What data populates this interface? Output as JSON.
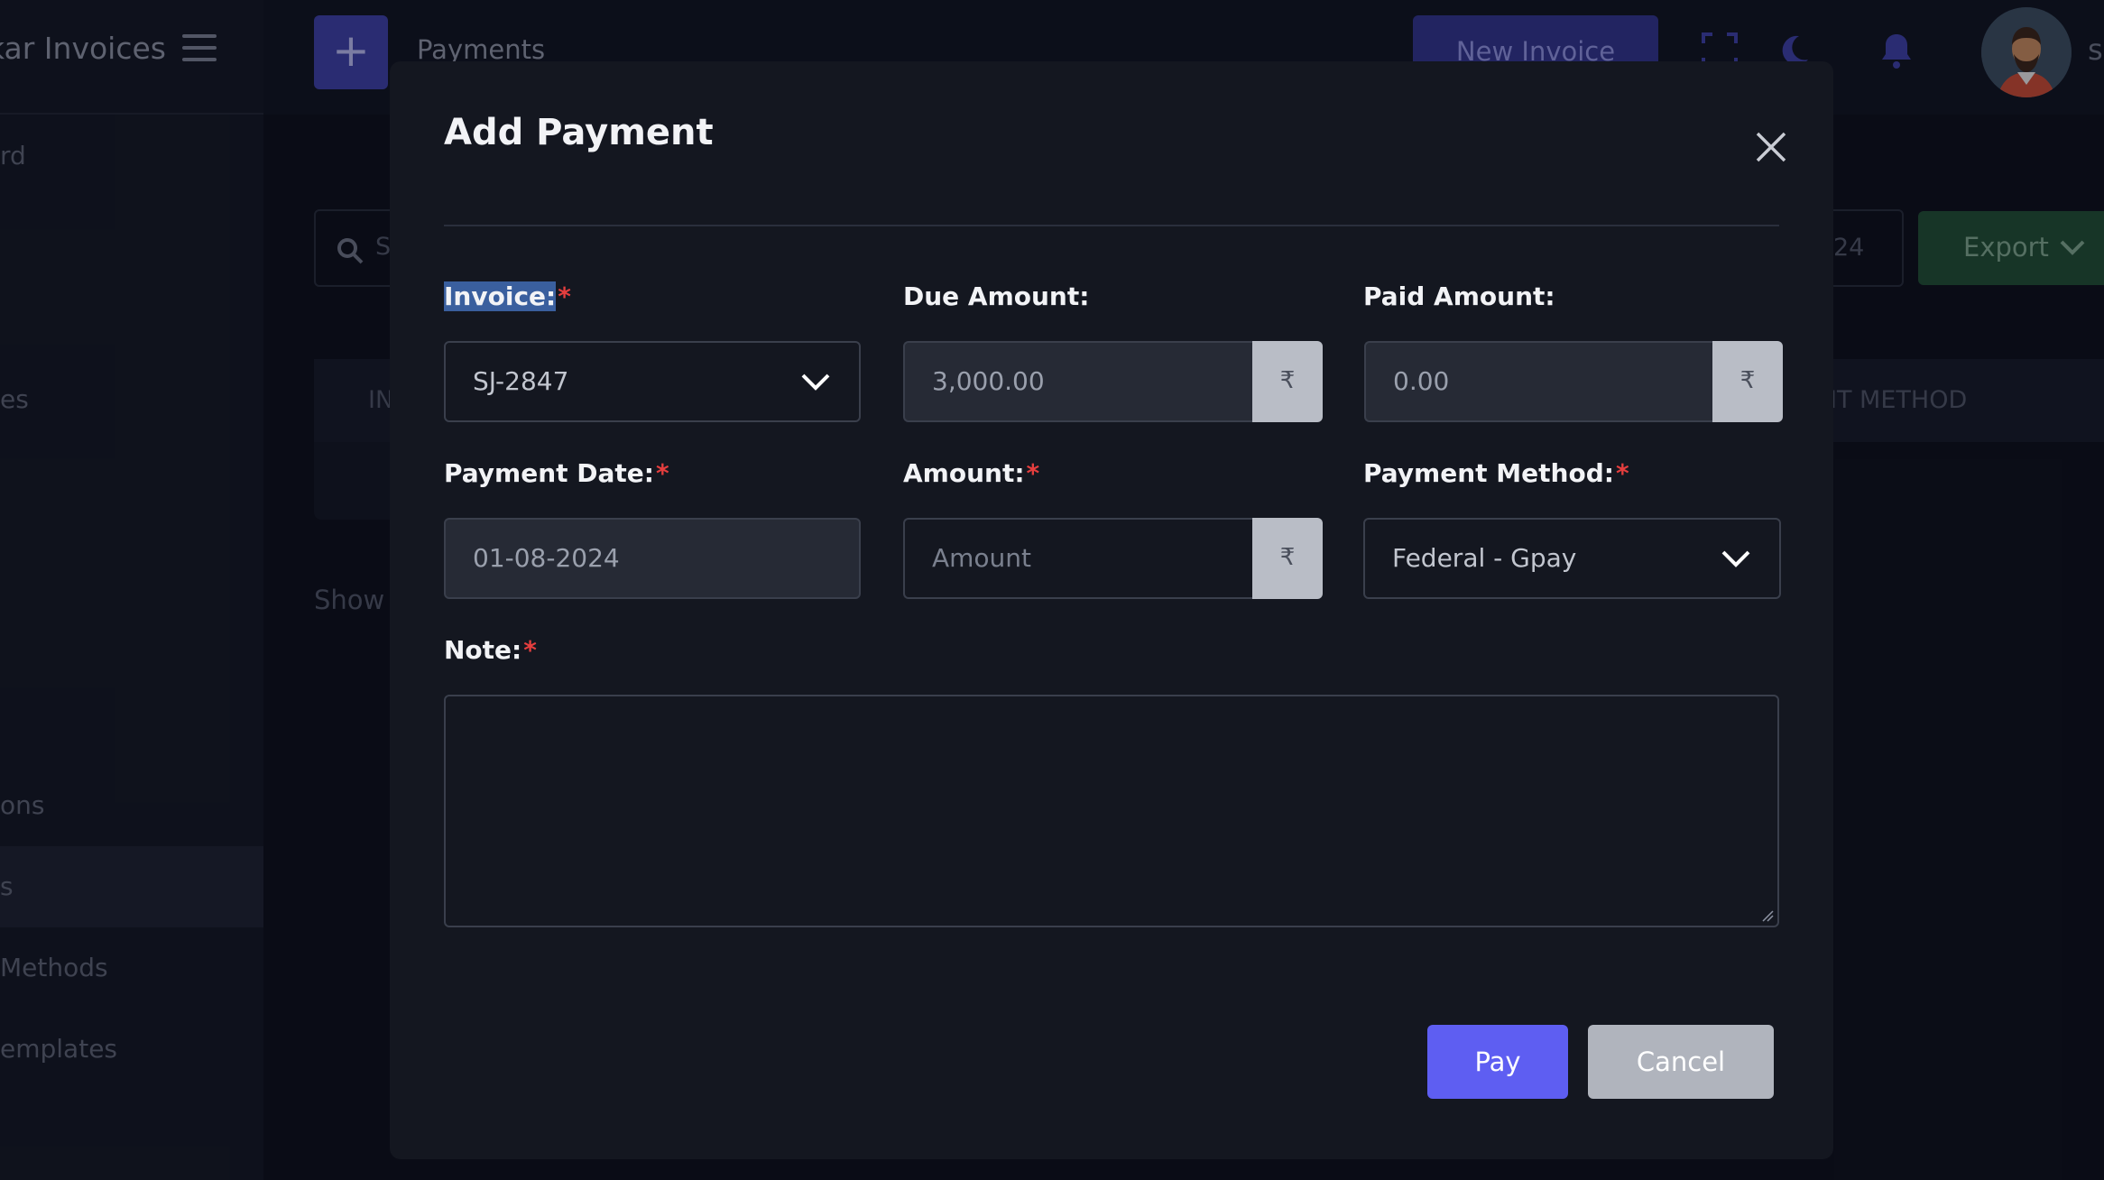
{
  "app": {
    "brand": "kar Invoices",
    "page_title": "Payments",
    "new_invoice_label": "New Invoice",
    "user_initial": "s"
  },
  "sidebar": {
    "items": [
      {
        "label": "rd"
      },
      {
        "label": "es"
      },
      {
        "label": "ons"
      },
      {
        "label": "s"
      },
      {
        "label": "Methods"
      },
      {
        "label": "emplates"
      }
    ]
  },
  "toolbar": {
    "search_placeholder": "S",
    "date_fragment": "24",
    "export_label": "Export"
  },
  "table": {
    "col_first": "IN",
    "col_method": "IT METHOD"
  },
  "footer": {
    "show_label": "Show"
  },
  "modal": {
    "title": "Add Payment",
    "fields": {
      "invoice": {
        "label": "Invoice:",
        "required": "*",
        "value": "SJ-2847"
      },
      "due_amount": {
        "label": "Due Amount:",
        "value": "3,000.00",
        "addon": "₹"
      },
      "paid_amount": {
        "label": "Paid Amount:",
        "value": "0.00",
        "addon": "₹"
      },
      "payment_date": {
        "label": "Payment Date:",
        "required": "*",
        "value": "01-08-2024"
      },
      "amount": {
        "label": "Amount:",
        "required": "*",
        "placeholder": "Amount",
        "addon": "₹"
      },
      "payment_method": {
        "label": "Payment Method:",
        "required": "*",
        "value": "Federal - Gpay"
      },
      "note": {
        "label": "Note:",
        "required": "*",
        "value": ""
      }
    },
    "pay_label": "Pay",
    "cancel_label": "Cancel"
  },
  "colors": {
    "primary": "#5e5ef2",
    "required": "#e53e3e",
    "export": "#1f4e33"
  }
}
